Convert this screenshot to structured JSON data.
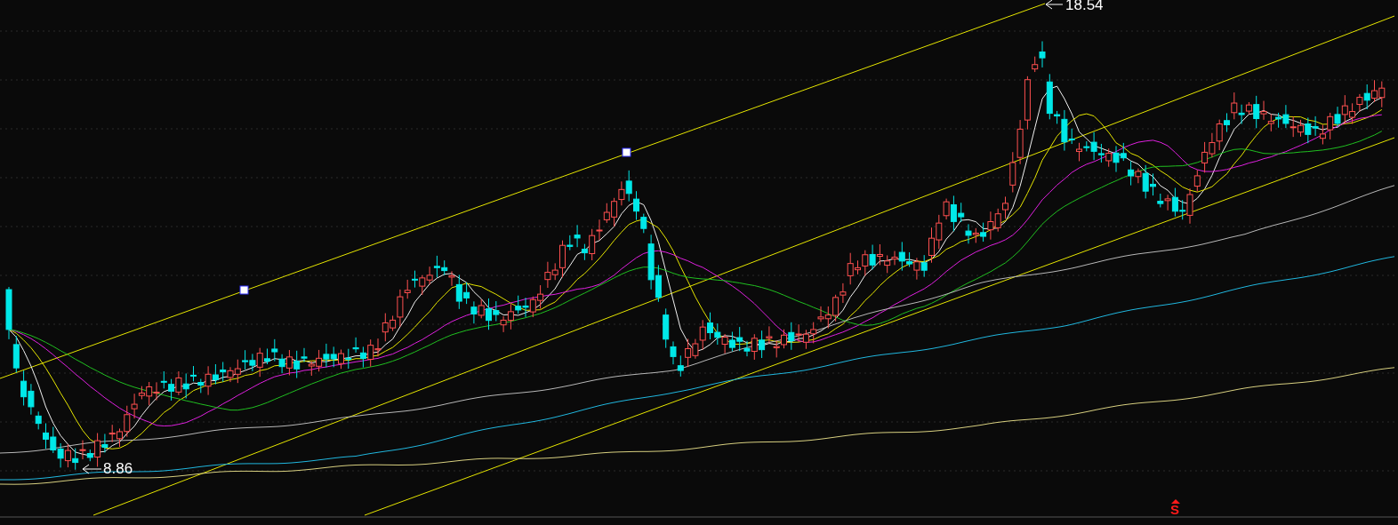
{
  "chart": {
    "high_label": {
      "text": "18.54"
    },
    "low_label": {
      "text": "8.86"
    },
    "signal_marker": {
      "text": "S"
    }
  }
}
